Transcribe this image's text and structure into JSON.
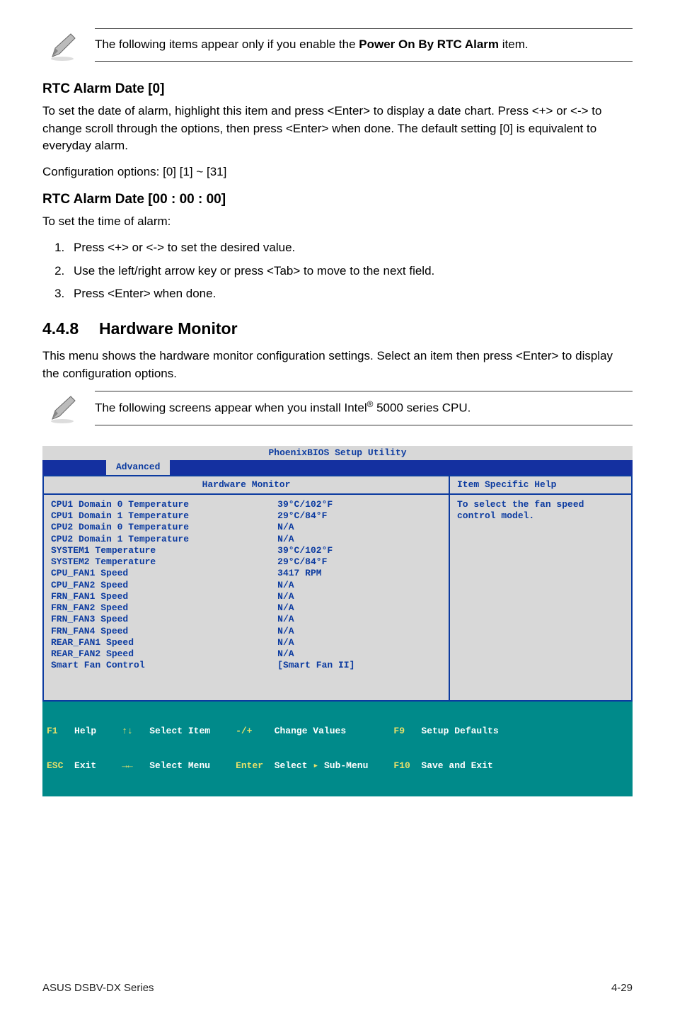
{
  "note1": "The following items appear only if you enable the ",
  "note1_bold": "Power On By RTC Alarm",
  "note1_after": " item.",
  "rtc_date_heading": "RTC Alarm Date [0]",
  "rtc_date_p1": "To set the date of alarm, highlight this item and press <Enter> to display a date chart. Press <+> or <-> to change scroll through the options, then press <Enter> when done. The default setting [0] is equivalent to everyday alarm.",
  "rtc_date_p2": "Configuration options: [0] [1] ~ [31]",
  "rtc_time_heading": "RTC Alarm Date [00 : 00 : 00]",
  "rtc_time_p": "To set the time of alarm:",
  "steps": [
    "Press <+> or <-> to set the desired value.",
    "Use the left/right arrow key or press <Tab> to move to the next field.",
    "Press <Enter> when done."
  ],
  "section_num": "4.4.8",
  "section_title": "Hardware Monitor",
  "section_p": "This menu shows the hardware monitor configuration settings.  Select an item then press <Enter> to display the configuration options.",
  "note2_before": "The following screens appear when you install Intel",
  "note2_after": " 5000 series CPU.",
  "note2_sup": "®",
  "bios": {
    "title": "PhoenixBIOS Setup Utility",
    "tab": "Advanced",
    "panel_title": "Hardware Monitor",
    "help_title": "Item Specific Help",
    "help_text1": "To select the fan speed",
    "help_text2": "control model.",
    "rows": [
      {
        "k": "CPU1 Domain 0 Temperature",
        "v": "39°C/102°F"
      },
      {
        "k": "CPU1 Domain 1 Temperature",
        "v": "29°C/84°F"
      },
      {
        "k": "CPU2 Domain 0 Temperature",
        "v": "N/A"
      },
      {
        "k": "CPU2 Domain 1 Temperature",
        "v": "N/A"
      },
      {
        "k": "SYSTEM1 Temperature",
        "v": "39°C/102°F"
      },
      {
        "k": "SYSTEM2 Temperature",
        "v": "29°C/84°F"
      },
      {
        "k": "CPU_FAN1 Speed",
        "v": "3417 RPM"
      },
      {
        "k": "CPU_FAN2 Speed",
        "v": "N/A"
      },
      {
        "k": "FRN_FAN1 Speed",
        "v": "N/A"
      },
      {
        "k": "FRN_FAN2 Speed",
        "v": "N/A"
      },
      {
        "k": "FRN_FAN3 Speed",
        "v": "N/A"
      },
      {
        "k": "FRN_FAN4 Speed",
        "v": "N/A"
      },
      {
        "k": "REAR_FAN1 Speed",
        "v": "N/A"
      },
      {
        "k": "REAR_FAN2 Speed",
        "v": "N/A"
      },
      {
        "k": "Smart Fan Control",
        "v": "[Smart Fan II]"
      }
    ],
    "footer": {
      "f1": "F1",
      "help": "Help",
      "updown": "↑↓",
      "select_item": "Select Item",
      "pm": "-/+",
      "change_values": "Change Values",
      "f9": "F9",
      "setup_defaults": "Setup Defaults",
      "esc": "ESC",
      "exit": "Exit",
      "lr": "→←",
      "select_menu": "Select Menu",
      "enter": "Enter",
      "select": "Select",
      "submenu": "Sub-Menu",
      "f10": "F10",
      "save_exit": "Save and Exit"
    }
  },
  "footer_left": "ASUS DSBV-DX Series",
  "footer_right": "4-29"
}
